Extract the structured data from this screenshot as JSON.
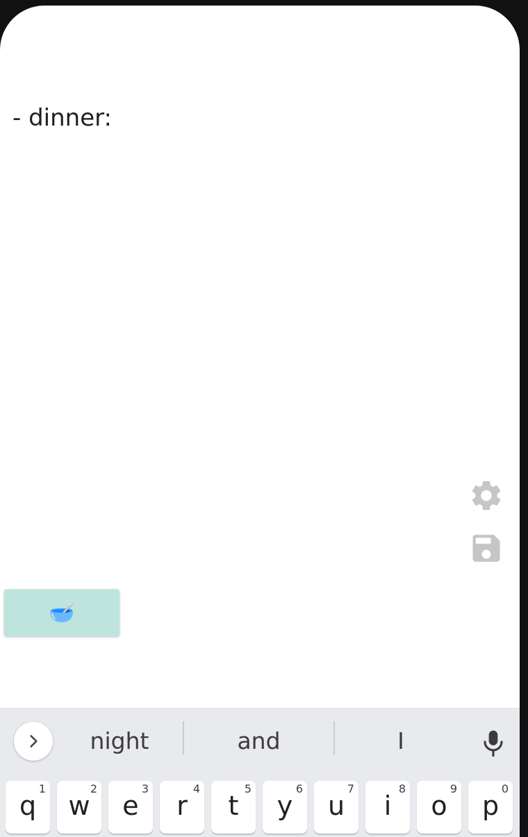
{
  "note": {
    "text": "- dinner:"
  },
  "sidebar_actions": {
    "settings_icon": "gear-icon",
    "save_icon": "floppy-disk-icon",
    "icon_color": "#c6c6c6"
  },
  "emoji_button": {
    "emoji": "🥣",
    "background": "#bde5dd"
  },
  "keyboard": {
    "suggestions": [
      "night",
      "and",
      "I"
    ],
    "keys": [
      {
        "letter": "q",
        "hint": "1"
      },
      {
        "letter": "w",
        "hint": "2"
      },
      {
        "letter": "e",
        "hint": "3"
      },
      {
        "letter": "r",
        "hint": "4"
      },
      {
        "letter": "t",
        "hint": "5"
      },
      {
        "letter": "y",
        "hint": "6"
      },
      {
        "letter": "u",
        "hint": "7"
      },
      {
        "letter": "i",
        "hint": "8"
      },
      {
        "letter": "o",
        "hint": "9"
      },
      {
        "letter": "p",
        "hint": "0"
      }
    ]
  }
}
